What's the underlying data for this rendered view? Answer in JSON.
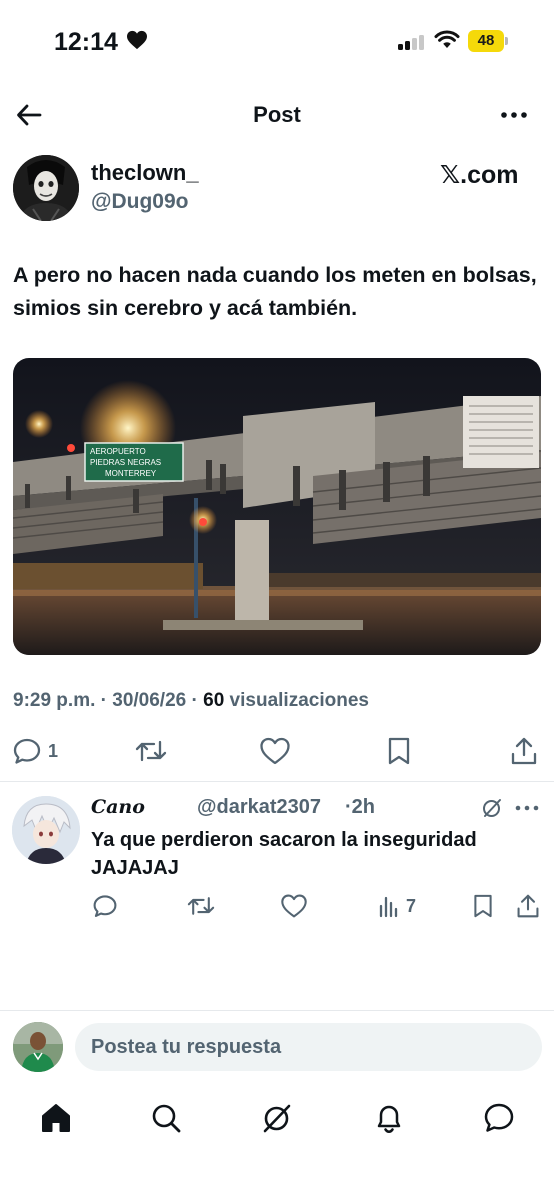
{
  "status_bar": {
    "time": "12:14",
    "battery": "48",
    "icons": [
      "heart-icon",
      "cellular-signal-icon",
      "wifi-icon",
      "battery-icon"
    ],
    "battery_color": "#f5d90a"
  },
  "header": {
    "title": "Post",
    "back_icon": "arrow-left-icon",
    "more_icon": "more-horizontal-icon"
  },
  "post": {
    "author": {
      "display_name": "theclown_",
      "handle": "@Dug09o",
      "source_link": "𝕏.com"
    },
    "text": "A pero no hacen nada cuando los meten en bolsas, simios sin cerebro y acá también.",
    "media": {
      "kind": "photo",
      "road_sign": {
        "line1": "AEROPUERTO",
        "line2": "PIEDRAS NEGRAS",
        "line3": "MONTERREY"
      }
    },
    "meta": {
      "time": "9:29 p.m.",
      "separator": "·",
      "date": "30/06/26",
      "views_count": "60",
      "views_label": "visualizaciones"
    },
    "actions": {
      "reply_count": "1",
      "icons": [
        "reply-icon",
        "repost-icon",
        "like-icon",
        "bookmark-icon",
        "share-icon"
      ]
    }
  },
  "reply": {
    "display_name": "Cano",
    "handle": "@darkat2307",
    "separator": "·",
    "time": "2h",
    "text": "Ya que perdieron sacaron la inseguridad JAJAJAJ",
    "views_count": "7",
    "icons": [
      "grok-icon",
      "more-horizontal-icon",
      "reply-icon",
      "repost-icon",
      "like-icon",
      "views-icon",
      "bookmark-icon",
      "share-icon"
    ]
  },
  "composer": {
    "placeholder": "Postea tu respuesta"
  },
  "tabbar": {
    "items": [
      "home-icon",
      "search-icon",
      "grok-icon",
      "notifications-icon",
      "messages-icon"
    ]
  },
  "colors": {
    "text_primary": "#0f1419",
    "text_secondary": "#536471",
    "divider": "#e6e9ec",
    "input_background": "#eff3f4",
    "sign_green": "#1f6b4a"
  }
}
